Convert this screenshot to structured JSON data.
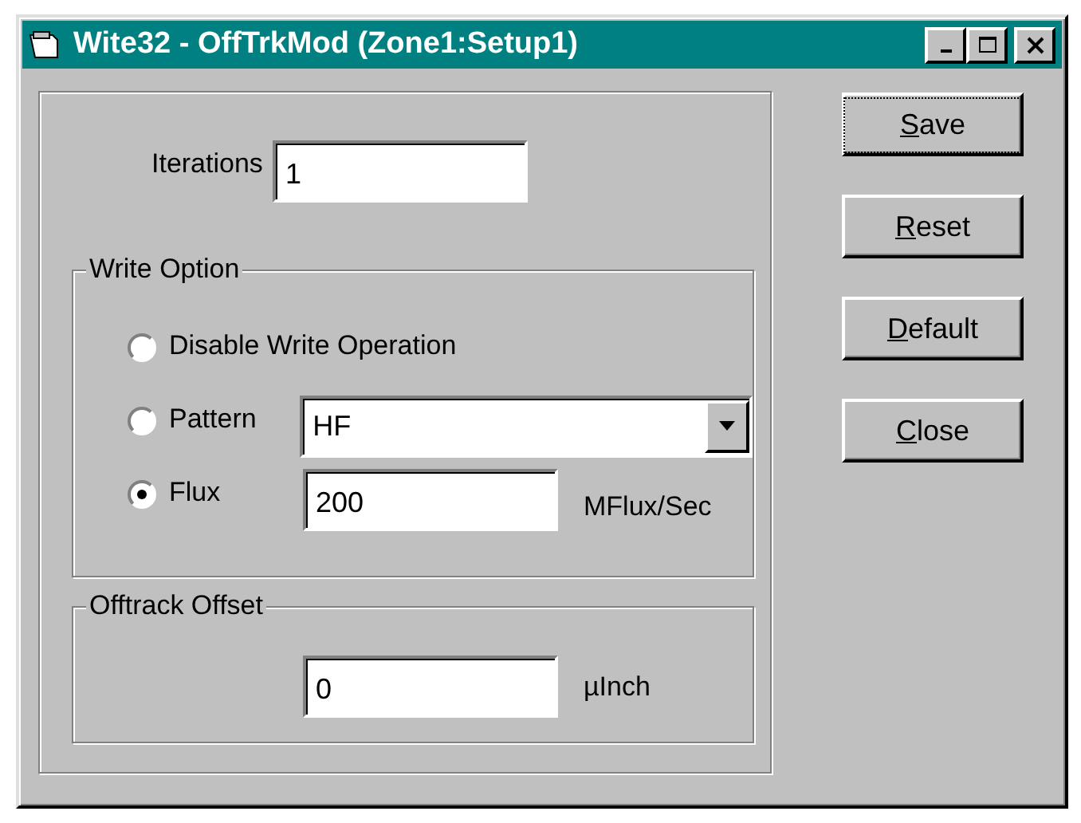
{
  "window": {
    "title": "Wite32 - OffTrkMod (Zone1:Setup1)"
  },
  "iterations": {
    "label": "Iterations",
    "value": "1"
  },
  "write_option": {
    "title": "Write Option",
    "options": [
      {
        "kind": "plain",
        "label": "Disable Write Operation",
        "selected": false
      },
      {
        "kind": "combo",
        "label": "Pattern",
        "selected": false,
        "value": "HF"
      },
      {
        "kind": "field",
        "label": "Flux",
        "selected": true,
        "value": "200",
        "unit": "MFlux/Sec"
      }
    ]
  },
  "offtrack_offset": {
    "title": "Offtrack Offset",
    "value": "0",
    "unit": "µInch"
  },
  "buttons": [
    {
      "mnemonic": "S",
      "rest": "ave",
      "focused": true
    },
    {
      "mnemonic": "R",
      "rest": "eset",
      "focused": false
    },
    {
      "mnemonic": "D",
      "rest": "efault",
      "focused": false
    },
    {
      "mnemonic": "C",
      "rest": "lose",
      "focused": false
    }
  ]
}
